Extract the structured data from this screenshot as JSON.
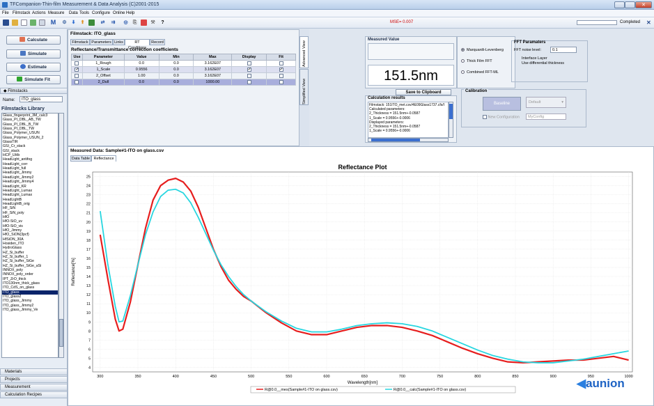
{
  "window": {
    "title": "TFCompanion-Thin-film Measurement & Data Analysis (C)2001-2015"
  },
  "menu": [
    "File",
    "Filmstack",
    "Actions",
    "Measure",
    "Data",
    "Tools",
    "Configure",
    "Online",
    "Help"
  ],
  "toolbar": {
    "mse": "MSE= 0.007",
    "status": "Completed",
    "help_symbol": "?"
  },
  "left": {
    "buttons": [
      "Calculate",
      "Simulate",
      "Estimate",
      "Simulate Fit"
    ],
    "filmstacks_header": "Filmstacks",
    "name_label": "Name:",
    "name_value": "ITO_glass",
    "library_title": "Filmstacks Library",
    "library": [
      "Glass_fingerprint_3M_calc3",
      "Glass_PI_DBL_AB_TW",
      "Glass_PI_DBL_B_TW",
      "Glass_PI_DBL_TW",
      "Glass_Polymer_USUN",
      "Glass_Polymer_USUN_2",
      "GlassTIR",
      "GSI_Cr_stack",
      "GSI_stack",
      "HCP_UHb",
      "HeadLight_antifog",
      "HeadLight_corr",
      "HeadLight_full",
      "HeadLight_Jimmy",
      "HeadLight_Jimmy2",
      "HeadLight_Jimmy4",
      "HeadLight_KR",
      "HeadLight_Lumax",
      "HeadLight_Lumax",
      "HeadLightB",
      "HeadLightB_orig",
      "HF_SiN",
      "HF_SiN_poly",
      "HfO",
      "HfO-SiO_uv",
      "HfO-SiO_vis",
      "HfO_Jimmy",
      "HfO_SiON(3pcf)",
      "HfSiON_30A",
      "Hosiden_ITO",
      "HydroGlass",
      "HZ_Si_buffer",
      "HZ_Si_buffer_1",
      "HZ_Si_buffer_SiGe",
      "HZ_Si_buffer_SiGe_aSi",
      "INNOX_poly",
      "INNOX_poly_order",
      "IPT_ZrO_thick",
      "ITO130nm_thick_glass",
      "ITO_CdS_on_glass",
      "ITO_glass",
      "ITO_glass2",
      "ITO_glass_Jimmy",
      "ITO_glass_Jimmy2",
      "ITO_glass_Jimmy_Ve"
    ],
    "selected_index": 40,
    "nav": [
      "Materials",
      "Projects",
      "Measurement",
      "Calculation Recipes"
    ]
  },
  "filmstack": {
    "title": "Filmstack: ITO_glass",
    "tabs": [
      "Filmstack",
      "Parameters",
      "Links",
      "RT Conditions",
      "Record"
    ],
    "table_title": "Reflectance/Transmittance correction coefficients",
    "columns": [
      "Use",
      "Parameter",
      "Value",
      "Min",
      "Max",
      "Display",
      "Fit"
    ],
    "rows": [
      {
        "use": false,
        "name": "1_Rough",
        "value": "0.0",
        "min": "0.0",
        "max": "3.162E07",
        "display": false,
        "fit": false
      },
      {
        "use": true,
        "name": "1_Scale",
        "value": "0.9556",
        "min": "0.0",
        "max": "3.162E07",
        "display": true,
        "fit": true
      },
      {
        "use": false,
        "name": "2_Offset",
        "value": "1.00",
        "min": "0.0",
        "max": "3.162E07",
        "display": false,
        "fit": false
      },
      {
        "use": false,
        "name": "2_Dull",
        "value": "0.0",
        "min": "0.0",
        "max": "1000.00",
        "display": false,
        "fit": false
      }
    ],
    "side_tabs": [
      "Advanced View",
      "Simplified View"
    ]
  },
  "measured": {
    "label": "Measured Value",
    "value": "151.5nm",
    "methods": [
      "Marquardt-Levenberg",
      "Thick Film FFT",
      "Combined FFT-ML"
    ],
    "selected_method": 0,
    "fft_title": "FFT Paramaters",
    "fft_noise_label": "FFT noise level:",
    "fft_noise_value": "0.1",
    "fft_opt1": "Interface Layer",
    "fft_opt2": "Use differential thickness",
    "save_button": "Save to Clipboard",
    "calc_title": "Calculation results",
    "calc_lines": [
      "Filmstack: 151ITO_met.csv/4E09Glass1737.cfs/I",
      "Calculated parameters:",
      "2_Thickness = 151.5nm+-0.0587",
      "1_Scale = 0.9556+-0.0006",
      "Displayed parameters:",
      "2_Thickness = 151.5nm+-0.0587",
      "1_Scale = 0.9556+-0.0006"
    ],
    "calib_title": "Calibration",
    "calib_btn": "Baseline",
    "calib_dd": "Default",
    "calib_chk": "New Configuration",
    "calib_cfg": "MyConfig"
  },
  "data": {
    "title": "Measured Data: Sample#1-ITO on glass.csv",
    "tabs": [
      "Data Table",
      "Reflectance"
    ]
  },
  "brand": {
    "name": "aunion"
  },
  "chart_data": {
    "type": "line",
    "title": "Reflectance Plot",
    "xlabel": "Wavelength[nm]",
    "ylabel": "Reflectance[%]",
    "xlim": [
      290,
      1005
    ],
    "ylim": [
      3.5,
      25.5
    ],
    "xticks": [
      300,
      350,
      400,
      450,
      500,
      550,
      600,
      650,
      700,
      750,
      800,
      850,
      900,
      950,
      1000
    ],
    "yticks": [
      4,
      5,
      6,
      7,
      8,
      9,
      10,
      11,
      12,
      13,
      14,
      15,
      16,
      17,
      18,
      19,
      20,
      21,
      22,
      23,
      24,
      25
    ],
    "x": [
      300,
      310,
      320,
      325,
      330,
      340,
      350,
      360,
      370,
      380,
      390,
      400,
      410,
      420,
      430,
      440,
      450,
      460,
      470,
      480,
      490,
      500,
      520,
      540,
      560,
      580,
      600,
      620,
      640,
      660,
      680,
      700,
      720,
      740,
      760,
      780,
      800,
      820,
      840,
      860,
      880,
      900,
      920,
      940,
      960,
      980,
      1000
    ],
    "series": [
      {
        "name": "R@0.0__mes(Sample#1-ITO on glass.csv)",
        "color": "#e61e1e",
        "values": [
          18.6,
          13.8,
          9.3,
          8.0,
          8.2,
          11.2,
          15.3,
          19.3,
          22.4,
          24.0,
          24.6,
          24.8,
          24.4,
          23.4,
          21.6,
          19.3,
          17.0,
          15.1,
          13.6,
          12.6,
          11.8,
          11.3,
          10.0,
          8.9,
          8.0,
          7.6,
          7.6,
          8.0,
          8.4,
          8.6,
          8.6,
          8.4,
          8.0,
          7.5,
          6.8,
          6.1,
          5.5,
          5.0,
          4.6,
          4.5,
          4.6,
          4.7,
          4.8,
          4.8,
          5.0,
          5.2,
          4.8
        ]
      },
      {
        "name": "R@0.0__calc(Sample#1-ITO on glass.csv)",
        "color": "#28d6e0",
        "values": [
          21.2,
          15.4,
          10.7,
          9.0,
          9.1,
          11.9,
          15.3,
          18.6,
          21.1,
          22.8,
          23.5,
          23.6,
          23.2,
          22.1,
          20.5,
          18.7,
          16.9,
          15.3,
          14.0,
          12.9,
          12.0,
          11.3,
          10.1,
          9.1,
          8.3,
          7.9,
          7.9,
          8.2,
          8.6,
          8.8,
          8.9,
          8.8,
          8.5,
          8.0,
          7.3,
          6.6,
          5.9,
          5.3,
          4.9,
          4.6,
          4.5,
          4.5,
          4.7,
          4.9,
          5.2,
          5.5,
          5.8
        ]
      }
    ]
  }
}
